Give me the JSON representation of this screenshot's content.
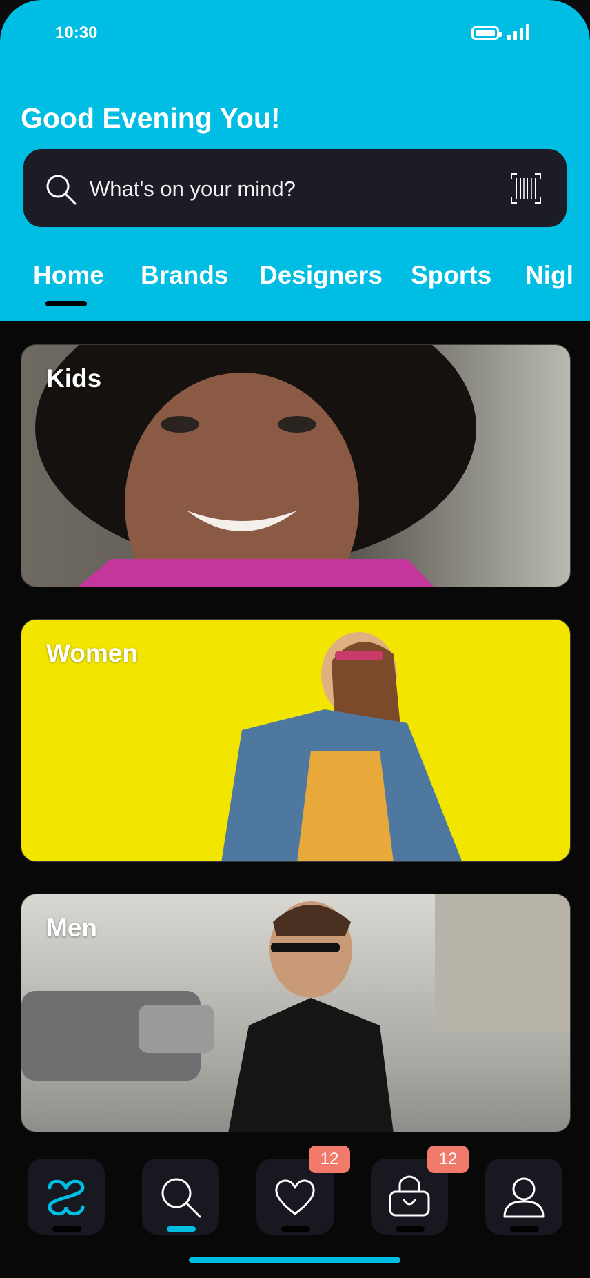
{
  "status": {
    "time": "10:30"
  },
  "header": {
    "greeting": "Good Evening You!",
    "search_placeholder": "What's on your mind?"
  },
  "tabs": [
    {
      "label": "Home",
      "active": true
    },
    {
      "label": "Brands"
    },
    {
      "label": "Designers"
    },
    {
      "label": "Sports"
    },
    {
      "label": "Nigl"
    }
  ],
  "categories": [
    {
      "label": "Kids"
    },
    {
      "label": "Women"
    },
    {
      "label": "Men"
    }
  ],
  "bottom_nav": {
    "items": [
      {
        "icon": "logo-icon",
        "active": false
      },
      {
        "icon": "search-icon",
        "active": true
      },
      {
        "icon": "heart-icon",
        "badge": "12"
      },
      {
        "icon": "bag-icon",
        "badge": "12"
      },
      {
        "icon": "user-icon"
      }
    ]
  },
  "colors": {
    "accent": "#00bde3",
    "badge": "#f27a6a",
    "search_bg": "#1b1c25"
  }
}
